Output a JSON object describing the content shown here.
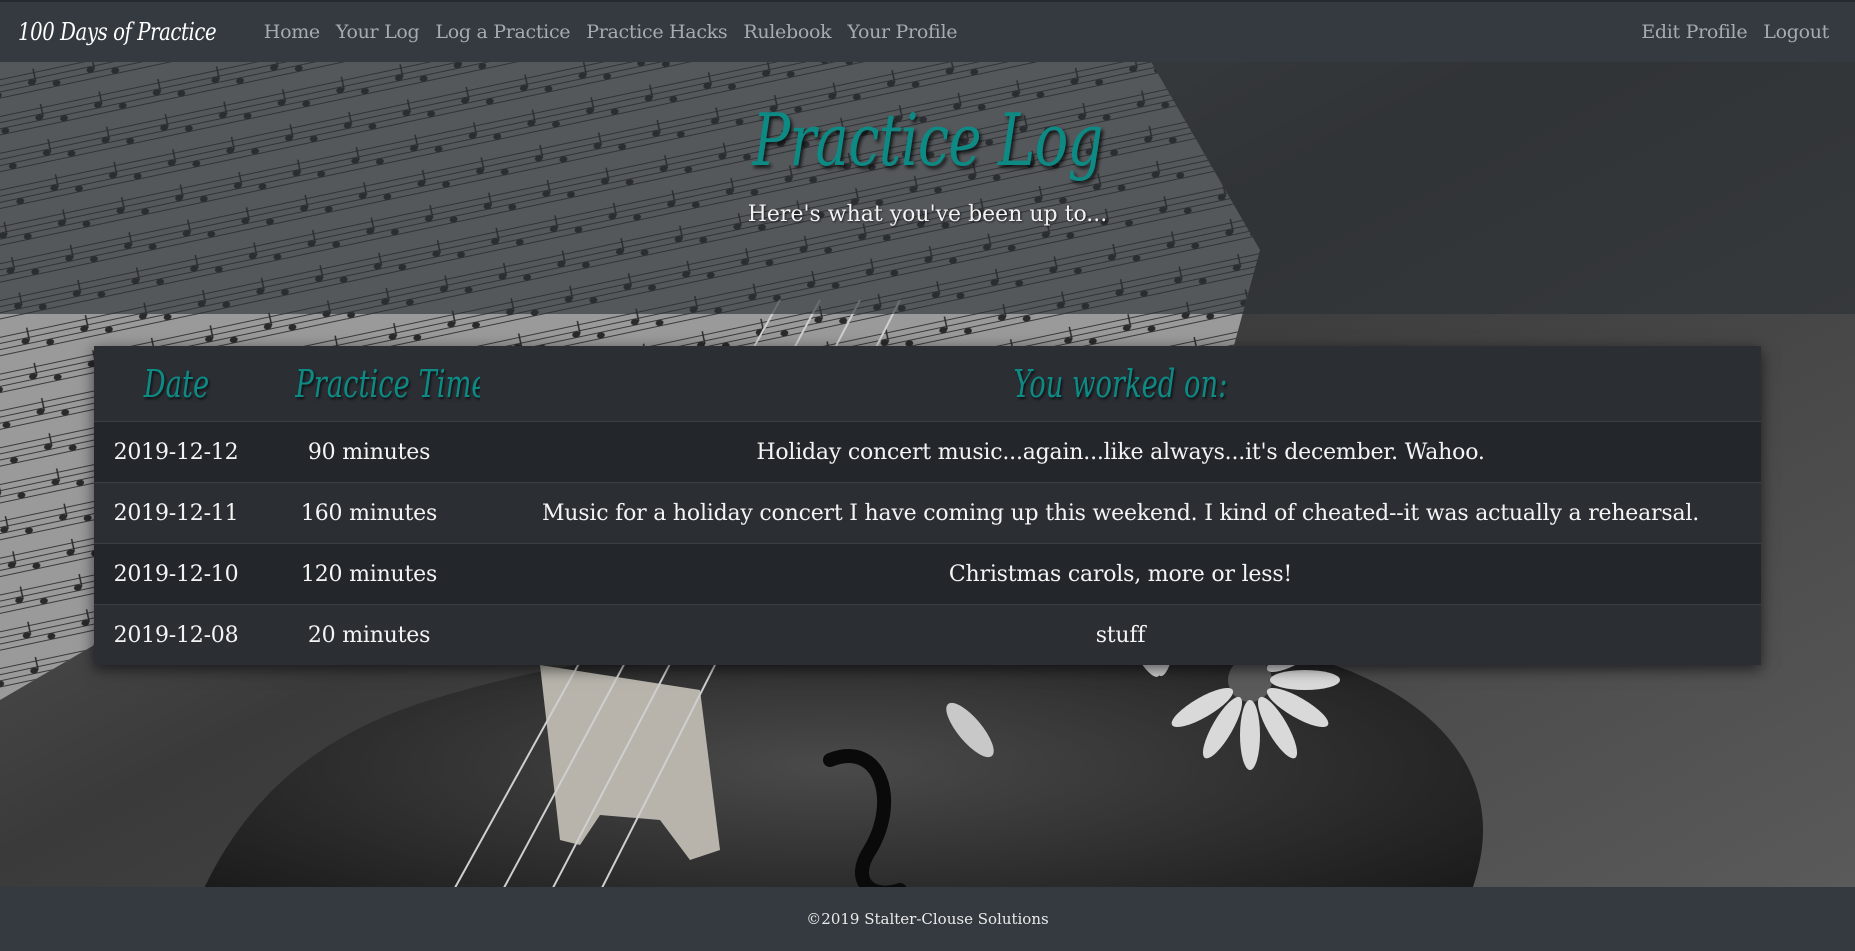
{
  "navbar": {
    "brand": "100 Days of Practice",
    "links": [
      "Home",
      "Your Log",
      "Log a Practice",
      "Practice Hacks",
      "Rulebook",
      "Your Profile"
    ],
    "right_links": [
      "Edit Profile",
      "Logout"
    ]
  },
  "jumbotron": {
    "title": "Practice Log",
    "subtitle": "Here's what you've been up to..."
  },
  "log_table": {
    "headers": [
      "Date",
      "Practice Time",
      "You worked on:"
    ],
    "rows": [
      {
        "date": "2019-12-12",
        "time": "90 minutes",
        "worked_on": "Holiday concert music...again...like always...it's december. Wahoo."
      },
      {
        "date": "2019-12-11",
        "time": "160 minutes",
        "worked_on": "Music for a holiday concert I have coming up this weekend. I kind of cheated--it was actually a rehearsal."
      },
      {
        "date": "2019-12-10",
        "time": "120 minutes",
        "worked_on": "Christmas carols, more or less!"
      },
      {
        "date": "2019-12-08",
        "time": "20 minutes",
        "worked_on": "stuff"
      }
    ]
  },
  "footer": {
    "text": "©2019 Stalter-Clouse Solutions"
  },
  "colors": {
    "accent": "#0e8a85",
    "navbar_bg": "#343a40",
    "table_dark": "#23272b",
    "table_light": "#2b2f34"
  }
}
